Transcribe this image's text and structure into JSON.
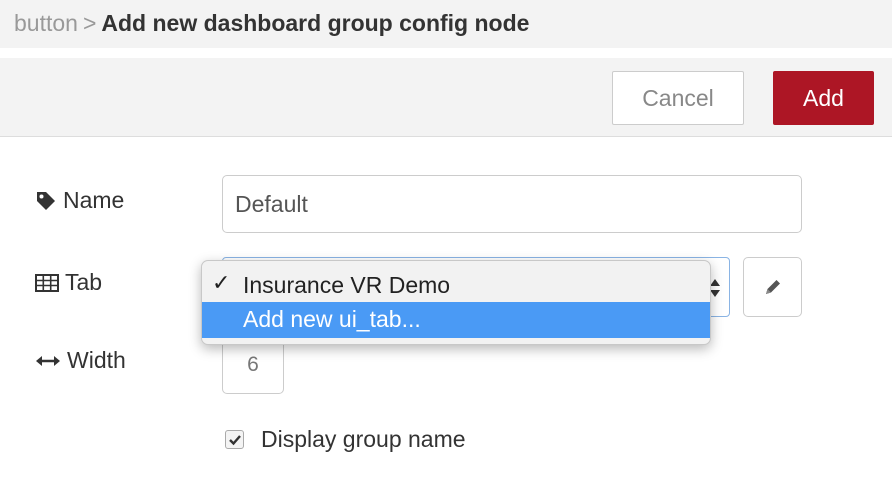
{
  "breadcrumb": {
    "parent": "button",
    "separator": ">",
    "current": "Add new dashboard group config node"
  },
  "toolbar": {
    "cancel_label": "Cancel",
    "add_label": "Add"
  },
  "form": {
    "name": {
      "label": "Name",
      "value": "Default",
      "icon": "tag-icon"
    },
    "tab": {
      "label": "Tab",
      "icon": "table-icon",
      "edit_icon": "pencil-icon"
    },
    "width": {
      "label": "Width",
      "value": "6",
      "icon": "horizontal-arrows-icon"
    },
    "display_group_name": {
      "label": "Display group name",
      "checked": true
    }
  },
  "tab_dropdown": {
    "options": [
      {
        "label": "Insurance VR Demo",
        "checked": true
      },
      {
        "label": "Add new ui_tab...",
        "highlighted": true
      }
    ],
    "checkmark": "✓"
  },
  "colors": {
    "accent": "#ad1625",
    "highlight": "#4a9af5",
    "panel_bg": "#f3f3f3"
  }
}
